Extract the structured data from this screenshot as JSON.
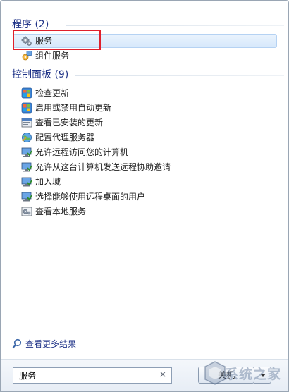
{
  "groups": {
    "programs": {
      "header": "程序 (2)",
      "items": [
        {
          "label": "服务",
          "icon": "gear-icon",
          "selected": true
        },
        {
          "label": "组件服务",
          "icon": "component-services-icon"
        }
      ]
    },
    "control_panel": {
      "header": "控制面板 (9)",
      "items": [
        {
          "label": "检查更新",
          "icon": "windows-update-icon"
        },
        {
          "label": "启用或禁用自动更新",
          "icon": "windows-update-icon"
        },
        {
          "label": "查看已安装的更新",
          "icon": "installed-updates-icon"
        },
        {
          "label": "配置代理服务器",
          "icon": "internet-options-icon"
        },
        {
          "label": "允许远程访问您的计算机",
          "icon": "system-icon"
        },
        {
          "label": "允许从这台计算机发送远程协助邀请",
          "icon": "system-icon"
        },
        {
          "label": "加入域",
          "icon": "system-icon"
        },
        {
          "label": "选择能够使用远程桌面的用户",
          "icon": "system-icon"
        },
        {
          "label": "查看本地服务",
          "icon": "services-icon"
        }
      ]
    }
  },
  "see_more": {
    "label": "查看更多结果",
    "icon": "search-icon"
  },
  "search": {
    "value": "服务",
    "clear_icon": "×"
  },
  "shutdown": {
    "label": "关机"
  },
  "watermark": {
    "text": "系统之家"
  },
  "colors": {
    "header": "#1e3287",
    "selection": "#d6e8fb",
    "annotation": "#e0202c"
  }
}
